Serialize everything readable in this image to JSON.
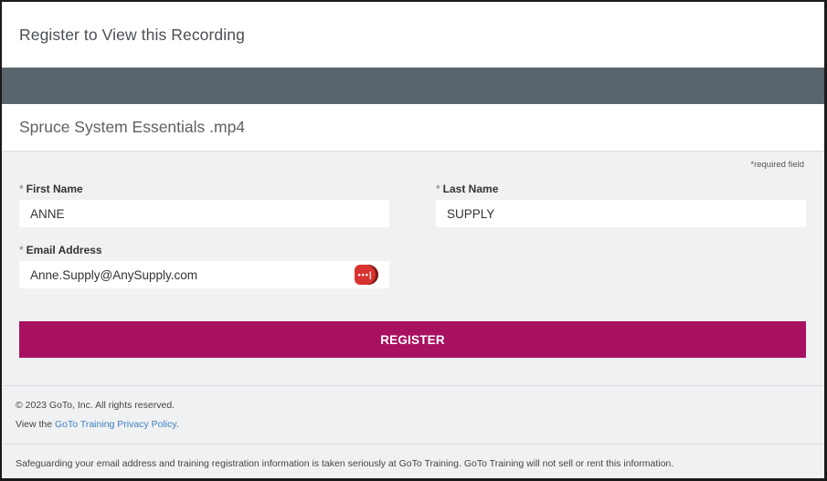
{
  "header": {
    "title": "Register to View this Recording"
  },
  "recording": {
    "title": "Spruce System Essentials .mp4"
  },
  "form": {
    "required_note": "*required field",
    "required_marker": "*",
    "first_name": {
      "label": "First Name",
      "value": "ANNE"
    },
    "last_name": {
      "label": "Last Name",
      "value": "SUPPLY"
    },
    "email": {
      "label": "Email Address",
      "value": "Anne.Supply@AnySupply.com"
    },
    "submit_label": "REGISTER"
  },
  "footer": {
    "copyright": "© 2023 GoTo, Inc. All rights reserved.",
    "privacy_prefix": "View the ",
    "privacy_link": "GoTo Training Privacy Policy",
    "privacy_suffix": ".",
    "disclaimer": "Safeguarding your email address and training registration information is taken seriously at GoTo Training. GoTo Training will not sell or rent this information."
  },
  "colors": {
    "banner": "#59646c",
    "register_button": "#a8115f",
    "link": "#3b7fc0",
    "password_manager_icon": "#d9332f"
  },
  "icons": {
    "password_manager": "password-manager-icon"
  }
}
